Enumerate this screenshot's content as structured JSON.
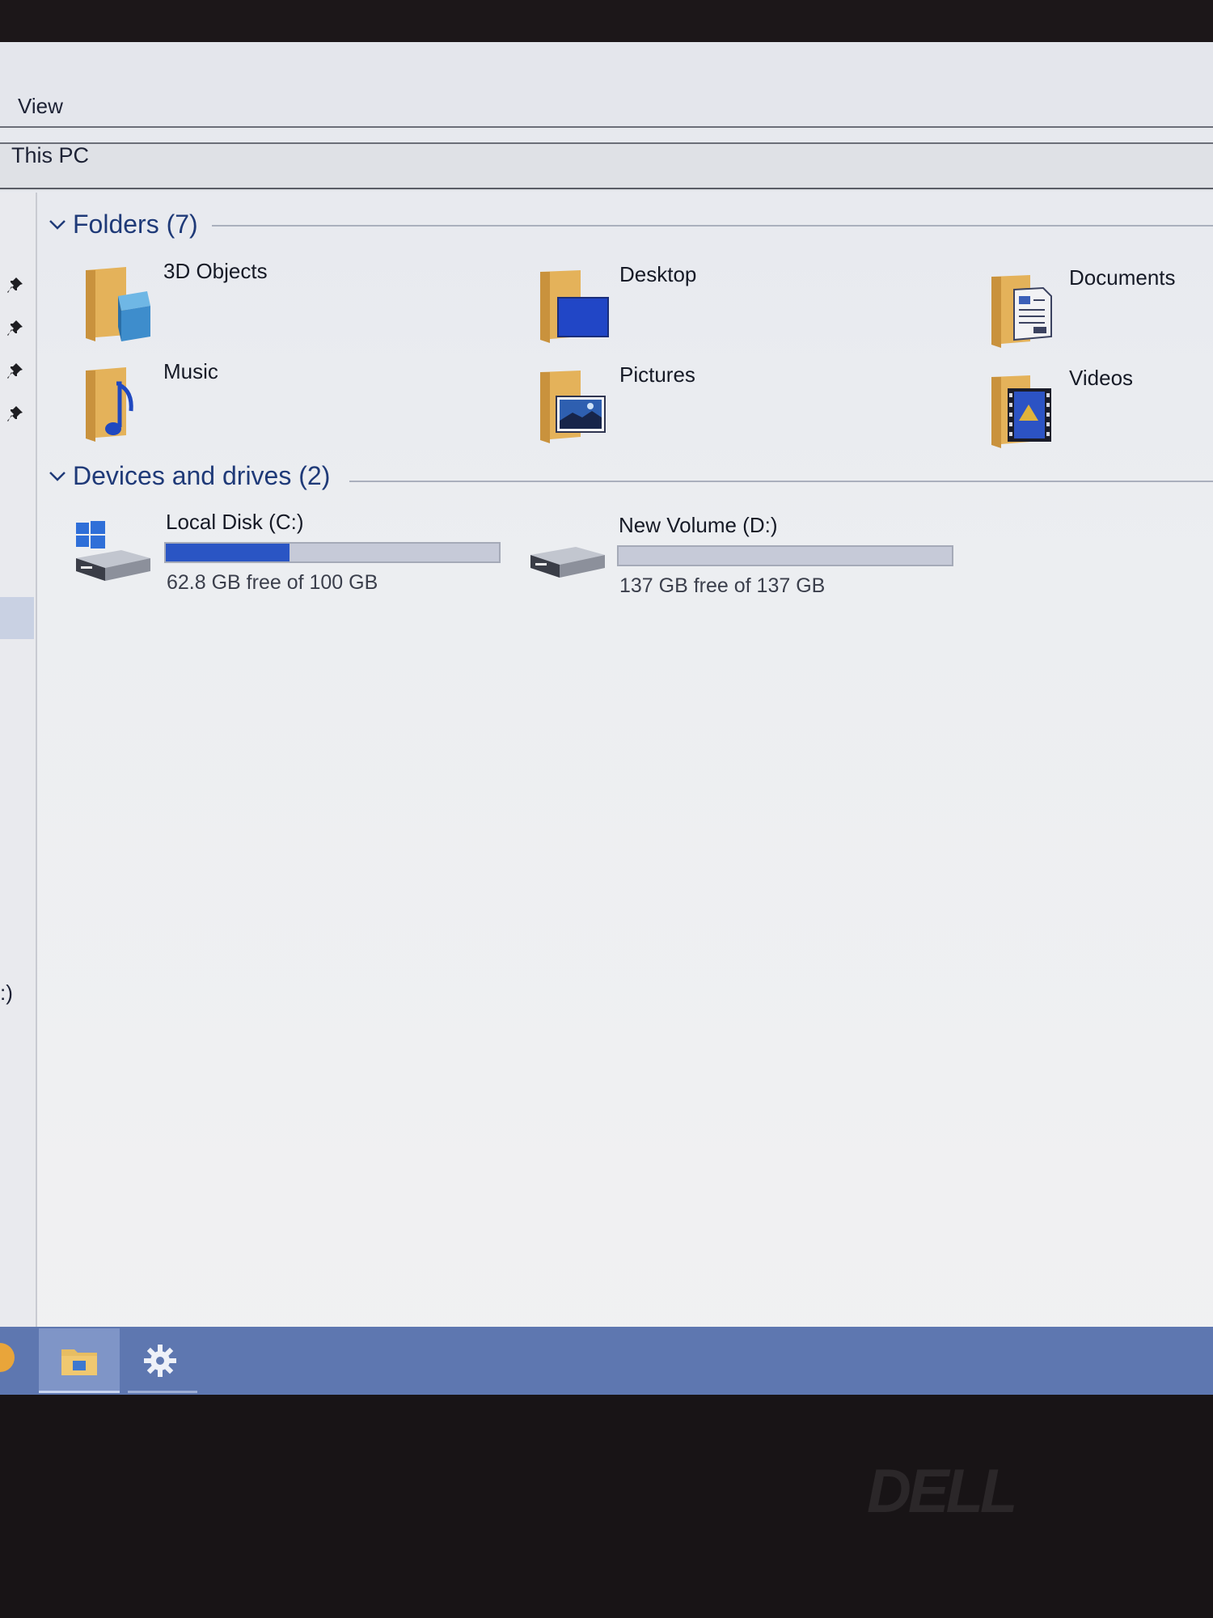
{
  "ribbon": {
    "view_tab": "View"
  },
  "address": {
    "location": "This PC"
  },
  "nav": {
    "pinned_icon": "pin-icon",
    "drive_partial_label": ":)"
  },
  "folders": {
    "header": "Folders (7)",
    "items": [
      {
        "label": "3D Objects",
        "icon": "3d-objects-folder-icon"
      },
      {
        "label": "Desktop",
        "icon": "desktop-folder-icon"
      },
      {
        "label": "Documents",
        "icon": "documents-folder-icon"
      },
      {
        "label": "Music",
        "icon": "music-folder-icon"
      },
      {
        "label": "Pictures",
        "icon": "pictures-folder-icon"
      },
      {
        "label": "Videos",
        "icon": "videos-folder-icon"
      }
    ]
  },
  "drives": {
    "header": "Devices and drives (2)",
    "items": [
      {
        "name": "Local Disk (C:)",
        "free_text": "62.8 GB free of 100 GB",
        "used_fraction": 0.372,
        "icon": "windows-drive-icon"
      },
      {
        "name": "New Volume (D:)",
        "free_text": "137 GB free of 137 GB",
        "used_fraction": 0.0,
        "icon": "drive-icon"
      }
    ]
  },
  "taskbar": {
    "items": [
      {
        "name": "chrome-icon"
      },
      {
        "name": "file-explorer-icon",
        "active": true
      },
      {
        "name": "settings-gear-icon"
      }
    ]
  },
  "hardware": {
    "brand": "DELL"
  },
  "colors": {
    "accent": "#2a55c4",
    "group_header": "#1f3a78",
    "taskbar": "#5e77b0",
    "folder": "#e4b25a"
  }
}
